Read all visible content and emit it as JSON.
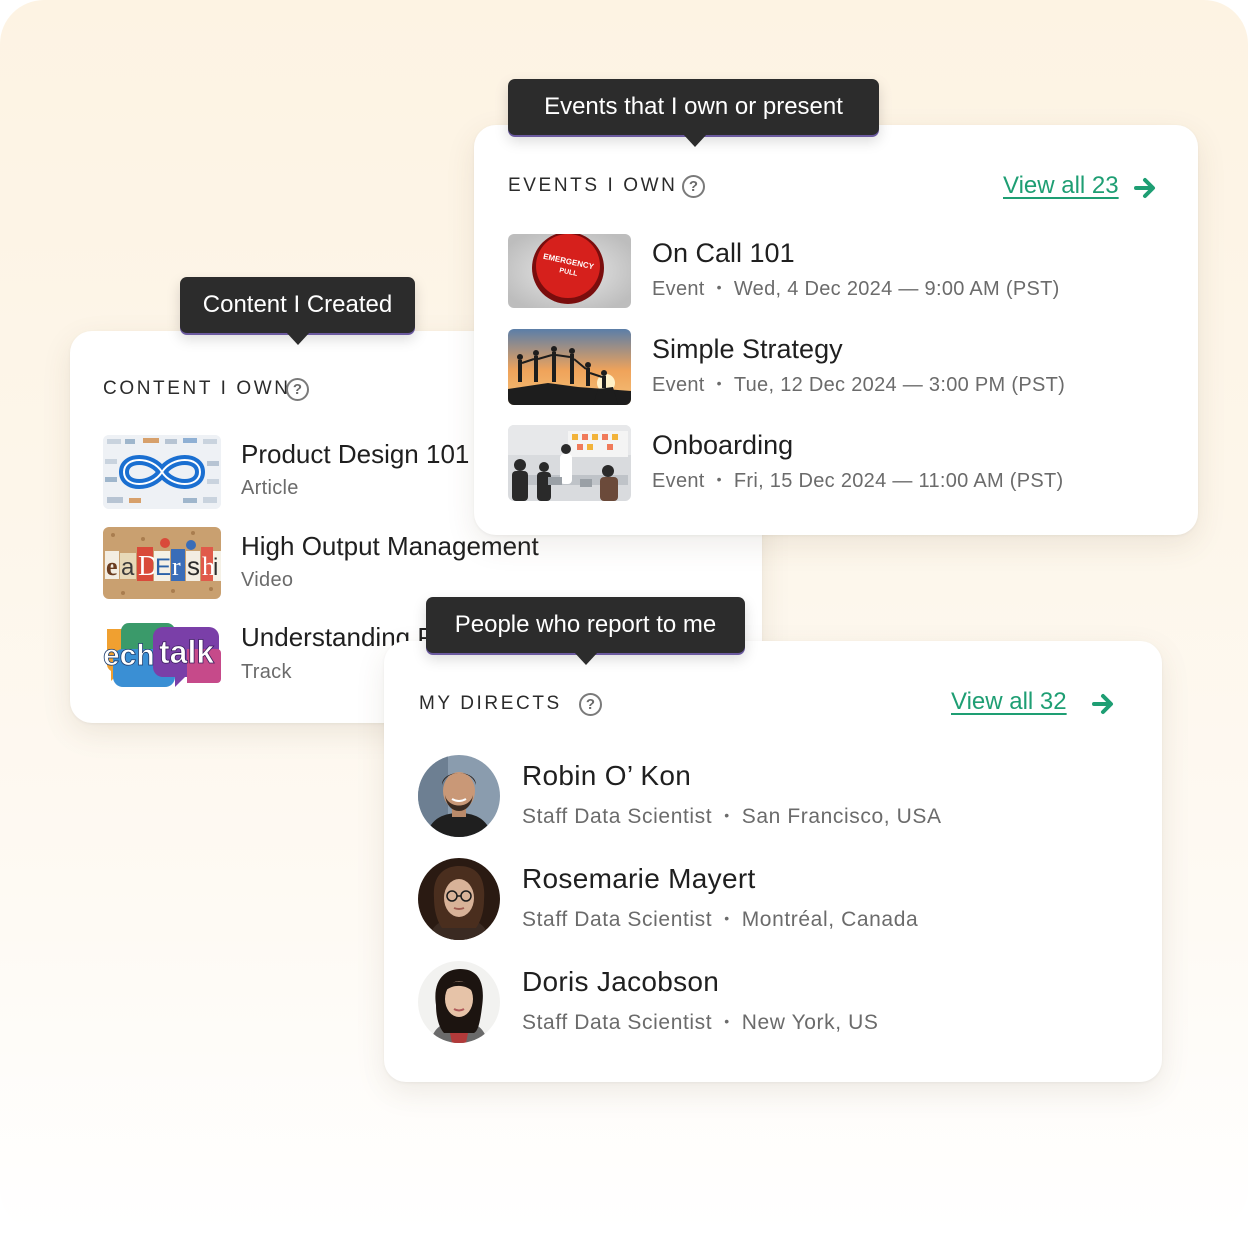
{
  "colors": {
    "accent": "#1e9e73",
    "tooltip_bg": "#2c2c2c",
    "background": "#fdf3e3"
  },
  "content": {
    "tooltip": "Content I Created",
    "title": "CONTENT I OWN",
    "help_icon": "question-circle-icon",
    "items": [
      {
        "title": "Product Design 101",
        "type": "Article"
      },
      {
        "title": "High Output Management",
        "type": "Video"
      },
      {
        "title": "Understanding Product Management",
        "type": "Track"
      }
    ]
  },
  "events": {
    "tooltip": "Events that I own or present",
    "title": "EVENTS I OWN",
    "help_icon": "question-circle-icon",
    "view_all": "View all 23",
    "arrow_icon": "arrow-right-icon",
    "items": [
      {
        "title": "On Call 101",
        "type": "Event",
        "when": "Wed, 4 Dec 2024 — 9:00 AM (PST)"
      },
      {
        "title": "Simple Strategy",
        "type": "Event",
        "when": "Tue, 12 Dec 2024 — 3:00 PM (PST)"
      },
      {
        "title": "Onboarding",
        "type": "Event",
        "when": "Fri, 15 Dec 2024 — 11:00 AM (PST)"
      }
    ]
  },
  "directs": {
    "tooltip": "People who report to me",
    "title": "MY DIRECTS",
    "help_icon": "question-circle-icon",
    "view_all": "View all 32",
    "arrow_icon": "arrow-right-icon",
    "people": [
      {
        "name": "Robin O’ Kon",
        "role": "Staff Data Scientist",
        "location": "San Francisco, USA"
      },
      {
        "name": "Rosemarie Mayert",
        "role": "Staff Data Scientist",
        "location": "Montréal, Canada"
      },
      {
        "name": "Doris Jacobson",
        "role": "Staff Data Scientist",
        "location": "New York, US"
      }
    ]
  }
}
